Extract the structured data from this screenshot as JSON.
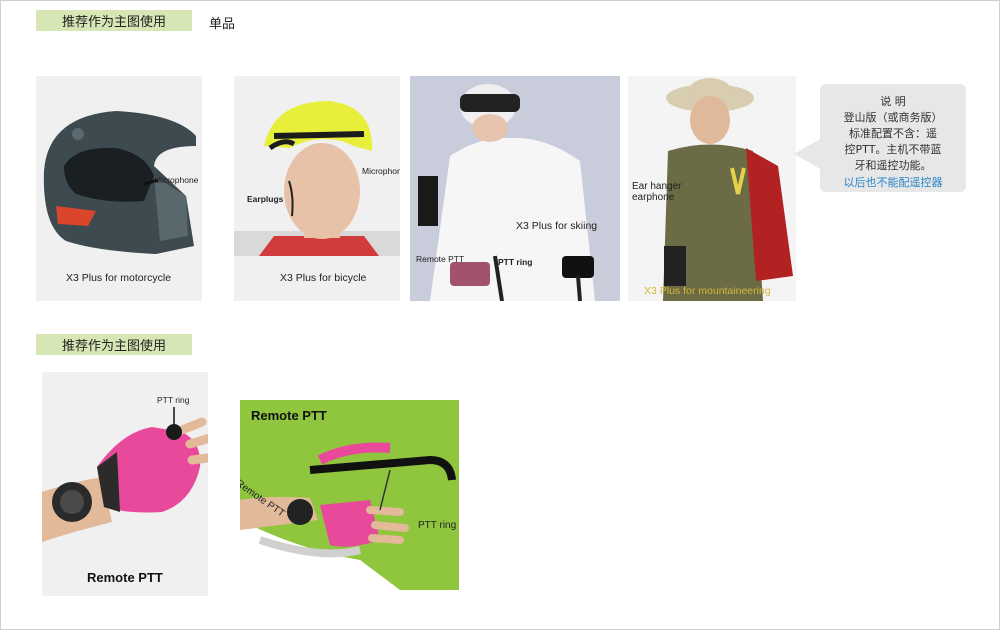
{
  "sections": {
    "top_tag": "推荐作为主图使用",
    "top_label": "单品",
    "bottom_tag": "推荐作为主图使用"
  },
  "cards": {
    "motorcycle": {
      "caption": "X3 Plus  for motorcycle",
      "callout": "Microphone"
    },
    "bicycle": {
      "caption": "X3 Plus  for bicycle",
      "callout_mic": "Microphone",
      "callout_ear": "Earplugs"
    },
    "skiing": {
      "caption": "X3 Plus  for skiing",
      "callout_ptt": "Remote PTT",
      "callout_ring": "PTT ring"
    },
    "mountaineering": {
      "caption": "X3 Plus  for mountaineering",
      "callout_line1": "Ear hanger",
      "callout_line2": "earphone"
    },
    "remote_ptt_white": {
      "caption": "Remote PTT",
      "callout": "PTT ring"
    },
    "remote_ptt_green": {
      "title": "Remote PTT",
      "side_label": "Remote PTT",
      "callout": "PTT ring"
    }
  },
  "note": {
    "title": "说 明",
    "line1": "登山版（或商务版）",
    "line2": "标准配置不含：遥",
    "line3": "控PTT。主机不带蓝",
    "line4": "牙和遥控功能。",
    "line5": "以后也不能配遥控器"
  },
  "colors": {
    "tag_bg": "#d6e6b5",
    "note_bg": "#e7e7e7",
    "note_accent": "#2a86c8",
    "green_card_bg": "#8fc63d"
  }
}
